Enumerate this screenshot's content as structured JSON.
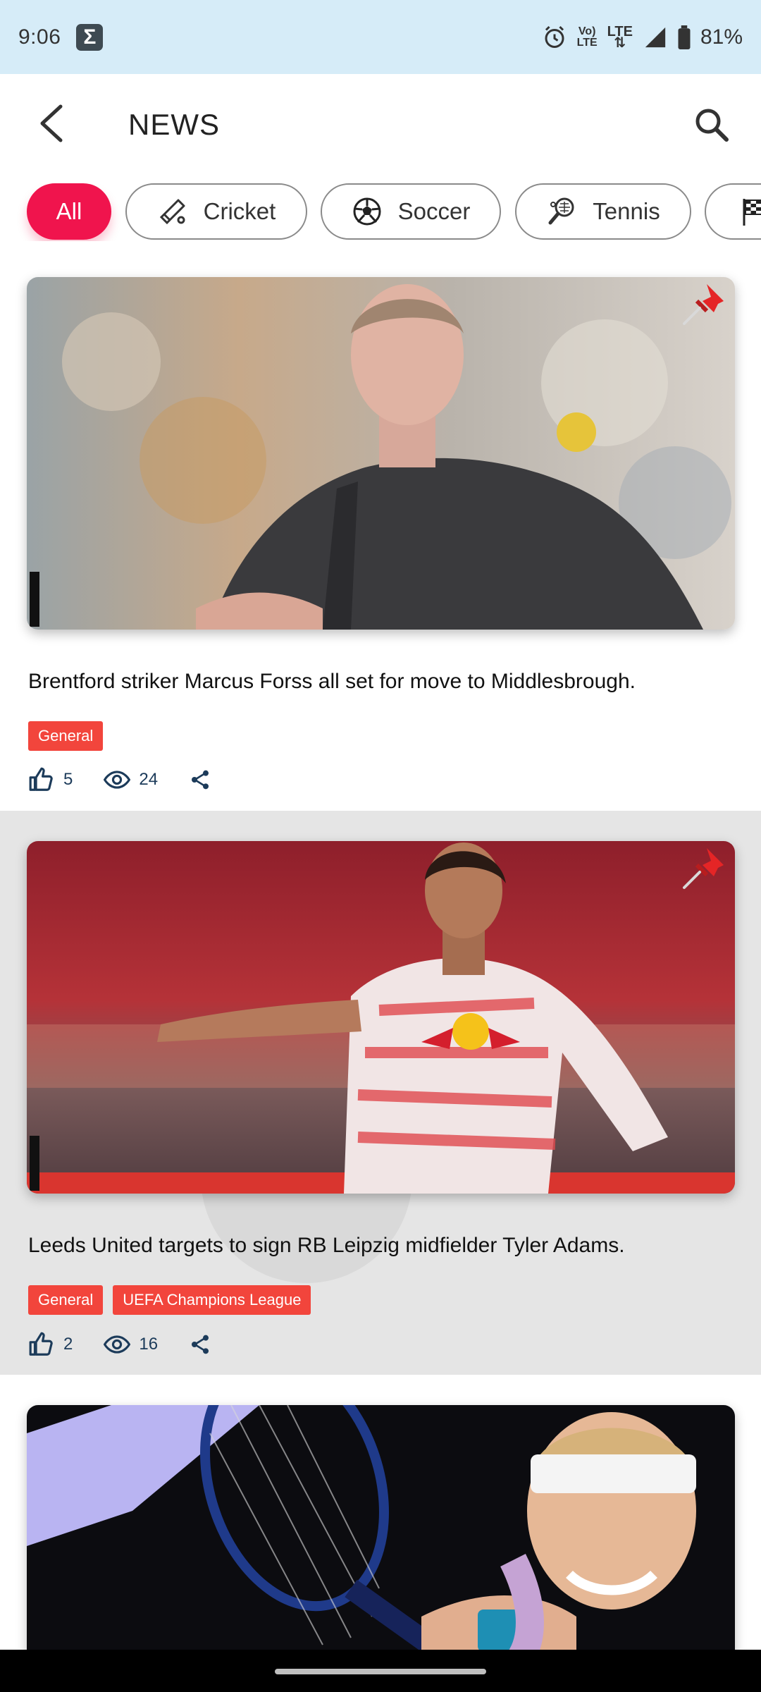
{
  "status_bar": {
    "time": "9:06",
    "notification_icon": "sigma-icon",
    "network_vo": "Vo\nLTE",
    "network_lte": "LTE",
    "battery": "81%"
  },
  "header": {
    "title": "NEWS",
    "back_icon": "chevron-left-icon",
    "search_icon": "search-icon"
  },
  "chips": [
    {
      "label": "All",
      "icon": "",
      "active": true
    },
    {
      "label": "Cricket",
      "icon": "cricket-bat-icon",
      "active": false
    },
    {
      "label": "Soccer",
      "icon": "soccer-ball-icon",
      "active": false
    },
    {
      "label": "Tennis",
      "icon": "tennis-racket-icon",
      "active": false
    },
    {
      "label": "",
      "icon": "checkered-flag-icon",
      "active": false
    }
  ],
  "news": [
    {
      "headline": "Brentford striker Marcus Forss all set for move to Middlesbrough.",
      "tags": [
        "General"
      ],
      "likes": "5",
      "views": "24",
      "pinned": true
    },
    {
      "headline": "Leeds United targets to sign RB Leipzig midfielder Tyler Adams.",
      "tags": [
        "General",
        "UEFA Champions League"
      ],
      "likes": "2",
      "views": "16",
      "pinned": true
    },
    {
      "headline": "",
      "tags": [],
      "likes": "",
      "views": "",
      "pinned": false
    }
  ],
  "colors": {
    "accent": "#f0144d",
    "tag": "#f2453c",
    "meta": "#1c3b5a",
    "status_bar": "#d6ecf8"
  }
}
